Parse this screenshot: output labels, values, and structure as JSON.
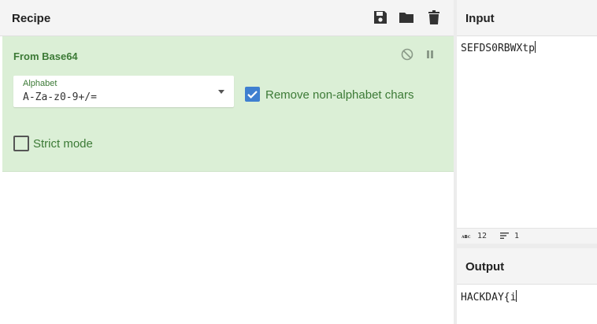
{
  "recipe": {
    "title": "Recipe",
    "icons": [
      "save-icon",
      "folder-icon",
      "trash-icon"
    ]
  },
  "operation": {
    "title": "From Base64",
    "disable_icon": "disable-icon",
    "pause_icon": "pause-icon",
    "alphabet": {
      "label": "Alphabet",
      "value": "A-Za-z0-9+/="
    },
    "remove_non_alphabet": {
      "label": "Remove non-alphabet chars",
      "checked": true
    },
    "strict_mode": {
      "label": "Strict mode",
      "checked": false
    }
  },
  "input": {
    "title": "Input",
    "value": "SEFDS0RBWXtp"
  },
  "status": {
    "length_icon": "abc-icon",
    "length": "12",
    "lines_icon": "lines-icon",
    "lines": "1"
  },
  "output": {
    "title": "Output",
    "value": "HACKDAY{i"
  },
  "colors": {
    "accent_green": "#3c7a36",
    "card_bg": "#dbefd6",
    "checkbox_blue": "#3f7fd0"
  }
}
